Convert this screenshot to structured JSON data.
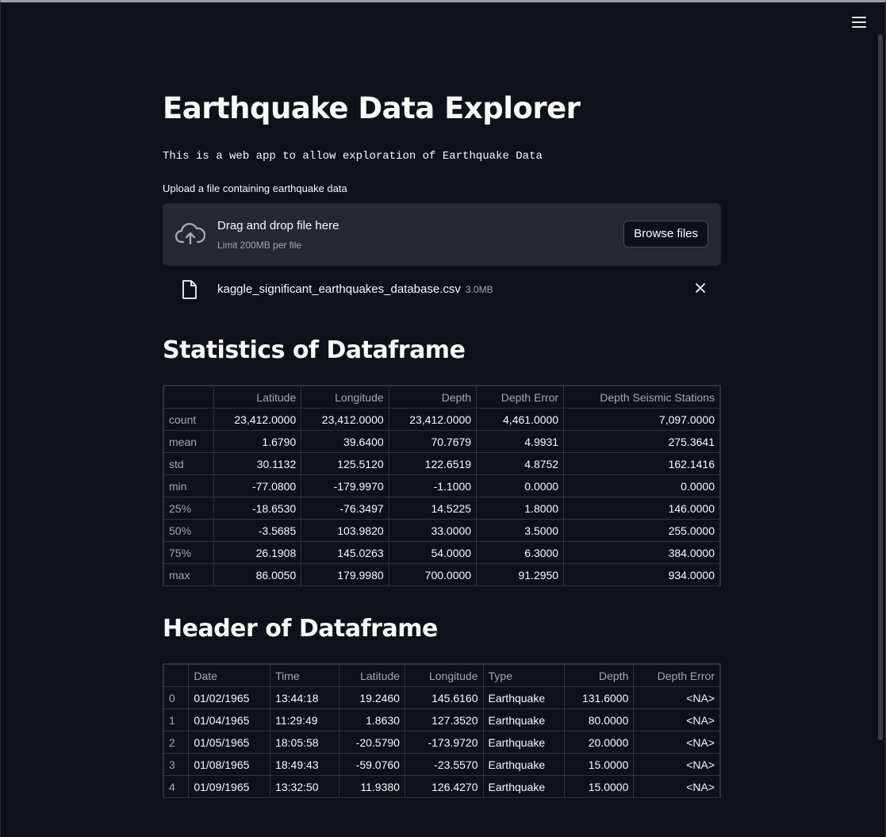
{
  "header": {
    "menu_icon": "hamburger-icon"
  },
  "main": {
    "title": "Earthquake Data Explorer",
    "subtitle": "This is a web app to allow exploration of Earthquake Data"
  },
  "uploader": {
    "label": "Upload a file containing earthquake data",
    "drag_text": "Drag and drop file here",
    "limit_text": "Limit 200MB per file",
    "browse_label": "Browse files",
    "icon": "cloud-upload-icon"
  },
  "file": {
    "name": "kaggle_significant_earthquakes_database.csv",
    "size": "3.0MB",
    "icon": "file-icon",
    "remove_icon": "close-icon"
  },
  "stats": {
    "title": "Statistics of Dataframe",
    "columns": [
      "",
      "Latitude",
      "Longitude",
      "Depth",
      "Depth Error",
      "Depth Seismic Stations"
    ],
    "rows": [
      [
        "count",
        "23,412.0000",
        "23,412.0000",
        "23,412.0000",
        "4,461.0000",
        "7,097.0000"
      ],
      [
        "mean",
        "1.6790",
        "39.6400",
        "70.7679",
        "4.9931",
        "275.3641"
      ],
      [
        "std",
        "30.1132",
        "125.5120",
        "122.6519",
        "4.8752",
        "162.1416"
      ],
      [
        "min",
        "-77.0800",
        "-179.9970",
        "-1.1000",
        "0.0000",
        "0.0000"
      ],
      [
        "25%",
        "-18.6530",
        "-76.3497",
        "14.5225",
        "1.8000",
        "146.0000"
      ],
      [
        "50%",
        "-3.5685",
        "103.9820",
        "33.0000",
        "3.5000",
        "255.0000"
      ],
      [
        "75%",
        "26.1908",
        "145.0263",
        "54.0000",
        "6.3000",
        "384.0000"
      ],
      [
        "max",
        "86.0050",
        "179.9980",
        "700.0000",
        "91.2950",
        "934.0000"
      ]
    ]
  },
  "head": {
    "title": "Header of Dataframe",
    "columns": [
      "",
      "Date",
      "Time",
      "Latitude",
      "Longitude",
      "Type",
      "Depth",
      "Depth Error"
    ],
    "rows": [
      [
        "0",
        "01/02/1965",
        "13:44:18",
        "19.2460",
        "145.6160",
        "Earthquake",
        "131.6000",
        "<NA>"
      ],
      [
        "1",
        "01/04/1965",
        "11:29:49",
        "1.8630",
        "127.3520",
        "Earthquake",
        "80.0000",
        "<NA>"
      ],
      [
        "2",
        "01/05/1965",
        "18:05:58",
        "-20.5790",
        "-173.9720",
        "Earthquake",
        "20.0000",
        "<NA>"
      ],
      [
        "3",
        "01/08/1965",
        "18:49:43",
        "-59.0760",
        "-23.5570",
        "Earthquake",
        "15.0000",
        "<NA>"
      ],
      [
        "4",
        "01/09/1965",
        "13:32:50",
        "11.9380",
        "126.4270",
        "Earthquake",
        "15.0000",
        "<NA>"
      ]
    ]
  }
}
